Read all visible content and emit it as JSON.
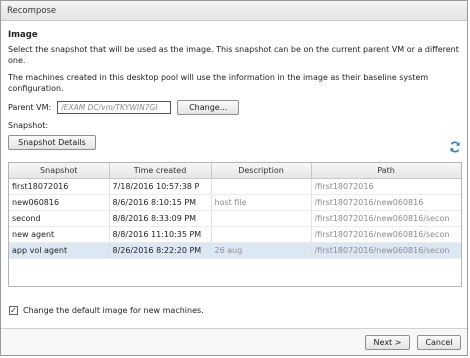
{
  "dialog": {
    "title": "Recompose"
  },
  "image_section": {
    "title": "Image",
    "instruction": "Select the snapshot that will be used as the image. This snapshot can be on the current parent VM or a different one.",
    "info": "The machines created in this desktop pool will use the information in the image as their baseline system configuration."
  },
  "parent_vm": {
    "label": "Parent VM:",
    "value": "/EXAM DC/vm/TKYWIN7GI",
    "change_button": "Change..."
  },
  "snapshot": {
    "label": "Snapshot:",
    "details_button": "Snapshot Details",
    "refresh_icon": "refresh-icon"
  },
  "table": {
    "columns": [
      "Snapshot",
      "Time created",
      "Description",
      "Path"
    ],
    "rows": [
      {
        "snapshot": "first18072016",
        "time": "7/18/2016 10:57:38 P",
        "description": "",
        "path": "/first18072016"
      },
      {
        "snapshot": "new060816",
        "time": "8/6/2016 8:10:15 PM",
        "description": "host file",
        "path": "/first18072016/new060816"
      },
      {
        "snapshot": "second",
        "time": "8/8/2016 8:33:09 PM",
        "description": "",
        "path": "/first18072016/new060816/secon"
      },
      {
        "snapshot": "new agent",
        "time": "8/8/2016 11:10:35 PM",
        "description": "",
        "path": "/first18072016/new060816/secon"
      },
      {
        "snapshot": "app vol agent",
        "time": "8/26/2016 8:22:20 PM",
        "description": "26 aug",
        "path": "/first18072016/new060816/secon"
      }
    ],
    "selected_index": 4
  },
  "default_image": {
    "label": "Change the default image for new machines.",
    "checked": true
  },
  "buttons": {
    "next": "Next >",
    "cancel": "Cancel"
  },
  "colors": {
    "selection": "#dbe8f4",
    "accent": "#2c7fc7"
  }
}
